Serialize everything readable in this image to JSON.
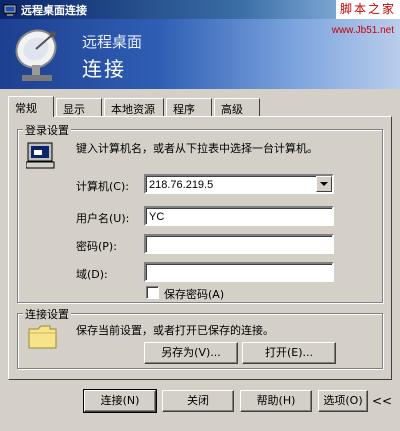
{
  "window": {
    "title": "远程桌面连接",
    "watermark_top": "脚本之家",
    "watermark_url": "www.Jb51.net"
  },
  "banner": {
    "line1": "远程桌面",
    "line2": "连接"
  },
  "tabs": [
    {
      "label": "常规",
      "active": true
    },
    {
      "label": "显示"
    },
    {
      "label": "本地资源"
    },
    {
      "label": "程序"
    },
    {
      "label": "高级"
    }
  ],
  "login": {
    "legend": "登录设置",
    "instruction": "键入计算机名，或者从下拉表中选择一台计算机。",
    "computer_label": "计算机(C):",
    "computer_value": "218.76.219.5",
    "username_label": "用户名(U):",
    "username_value": "YC",
    "password_label": "密码(P):",
    "password_value": "",
    "domain_label": "域(D):",
    "domain_value": "",
    "save_password_label": "保存密码(A)",
    "save_password_checked": false
  },
  "connection": {
    "legend": "连接设置",
    "instruction": "保存当前设置，或者打开已保存的连接。",
    "save_as_label": "另存为(V)...",
    "open_label": "打开(E)..."
  },
  "footer": {
    "connect_label": "连接(N)",
    "close_label": "关闭",
    "help_label": "帮助(H)",
    "options_label": "选项(O)",
    "collapse_glyph": "<<"
  }
}
